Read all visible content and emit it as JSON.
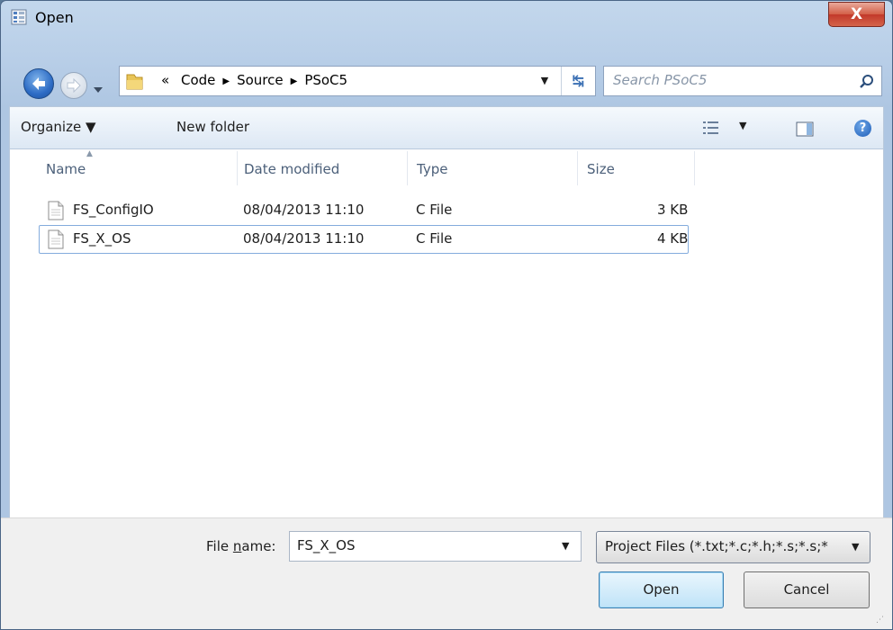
{
  "window": {
    "title": "Open",
    "close_label": "X"
  },
  "nav": {
    "breadcrumbs": [
      "«",
      "Code",
      "Source",
      "PSoC5"
    ],
    "search_placeholder": "Search PSoC5"
  },
  "toolbar": {
    "organize_label": "Organize ▼",
    "new_folder_label": "New folder"
  },
  "columns": {
    "name": "Name",
    "date": "Date modified",
    "type": "Type",
    "size": "Size"
  },
  "files": [
    {
      "name": "FS_ConfigIO",
      "date": "08/04/2013 11:10",
      "type": "C File",
      "size": "3 KB",
      "selected": false
    },
    {
      "name": "FS_X_OS",
      "date": "08/04/2013 11:10",
      "type": "C File",
      "size": "4 KB",
      "selected": true
    }
  ],
  "bottom": {
    "file_name_label_pre": "File ",
    "file_name_label_u": "n",
    "file_name_label_post": "ame:",
    "file_name_value": "FS_X_OS",
    "file_type_value": "Project Files (*.txt;*.c;*.h;*.s;*.s;*",
    "open_label": "Open",
    "cancel_label": "Cancel"
  },
  "icons": {
    "app": "dialog-icon",
    "back": "back-arrow-icon",
    "forward": "forward-arrow-icon",
    "folder": "folder-icon",
    "refresh": "refresh-icon",
    "search": "search-icon",
    "view": "view-options-icon",
    "pane": "preview-pane-icon",
    "help": "help-icon",
    "file": "c-file-icon"
  }
}
